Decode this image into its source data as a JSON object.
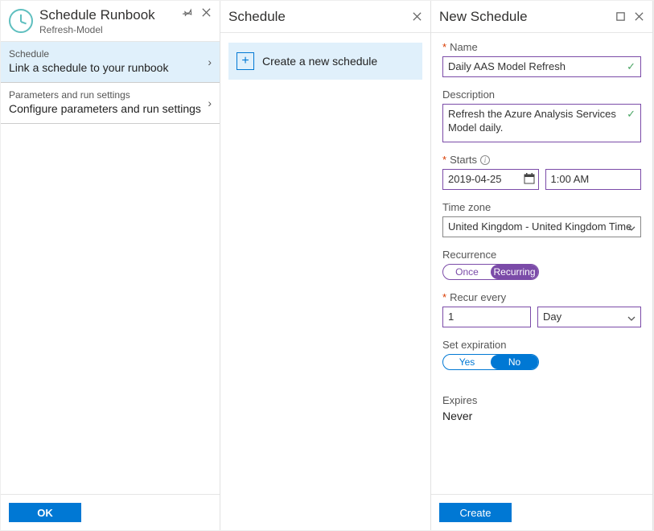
{
  "pane1": {
    "title": "Schedule Runbook",
    "subtitle": "Refresh-Model",
    "items": [
      {
        "small": "Schedule",
        "big": "Link a schedule to your runbook"
      },
      {
        "small": "Parameters and run settings",
        "big": "Configure parameters and run settings"
      }
    ],
    "ok": "OK"
  },
  "pane2": {
    "title": "Schedule",
    "create": "Create a new schedule"
  },
  "pane3": {
    "title": "New Schedule",
    "name_label": "Name",
    "name_value": "Daily AAS Model Refresh",
    "desc_label": "Description",
    "desc_value": "Refresh the Azure Analysis Services Model daily.",
    "starts_label": "Starts",
    "starts_date": "2019-04-25",
    "starts_time": "1:00 AM",
    "tz_label": "Time zone",
    "tz_value": "United Kingdom - United Kingdom Time",
    "recurrence_label": "Recurrence",
    "recurrence_once": "Once",
    "recurrence_recurring": "Recurring",
    "recur_every_label": "Recur every",
    "recur_every_value": "1",
    "recur_every_unit": "Day",
    "expire_label": "Set expiration",
    "expire_yes": "Yes",
    "expire_no": "No",
    "expires_label": "Expires",
    "expires_value": "Never",
    "create": "Create"
  }
}
